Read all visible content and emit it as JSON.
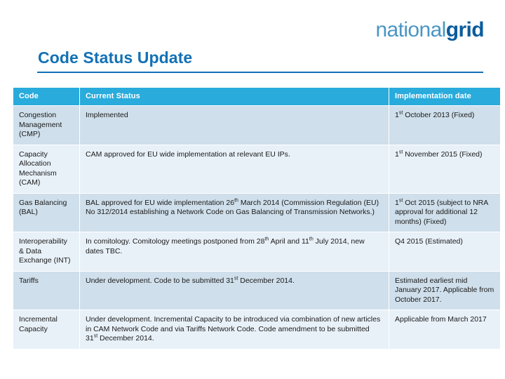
{
  "logo": {
    "text_light": "national",
    "text_bold": "grid"
  },
  "page_title": "Code Status Update",
  "colors": {
    "brand_blue": "#1271b5",
    "header_cyan": "#29ABDC",
    "row_dark": "#cfdfeb",
    "row_light": "#e8f1f8",
    "logo_light": "#4a96c4",
    "logo_bold": "#0b5c9c"
  },
  "table": {
    "headers": [
      "Code",
      "Current Status",
      "Implementation date"
    ],
    "rows": [
      {
        "code": "Congestion Management (CMP)",
        "status": "Implemented",
        "implementation": "1st October 2013 (Fixed)",
        "implementation_parts": [
          "1",
          "st",
          " October 2013 (Fixed)"
        ]
      },
      {
        "code": "Capacity Allocation Mechanism (CAM)",
        "status": "CAM approved for EU wide implementation at relevant EU IPs.",
        "implementation": "1st November 2015 (Fixed)",
        "implementation_parts": [
          "1",
          "st",
          " November 2015 (Fixed)"
        ]
      },
      {
        "code": "Gas Balancing (BAL)",
        "status": "BAL approved for EU wide implementation 26th March 2014 (Commission Regulation (EU) No 312/2014 establishing a Network Code on Gas Balancing of Transmission Networks.)",
        "status_parts": [
          "BAL approved for EU wide implementation 26",
          "th",
          " March 2014 (Commission Regulation (EU) No 312/2014 establishing a Network Code on Gas Balancing of Transmission Networks.)"
        ],
        "implementation": "1st Oct 2015 (subject to NRA approval for additional 12 months) (Fixed)",
        "implementation_parts": [
          "1",
          "st",
          " Oct 2015 (subject to NRA approval for additional 12 months) (Fixed)"
        ]
      },
      {
        "code": "Interoperability & Data Exchange (INT)",
        "status": "In comitology. Comitology meetings postponed from 28th April and 11th July 2014, new dates TBC.",
        "status_parts": [
          "In comitology. Comitology meetings postponed from 28",
          "th",
          " April and 11",
          "th",
          " July 2014, new dates TBC."
        ],
        "implementation": "Q4 2015 (Estimated)"
      },
      {
        "code": "Tariffs",
        "status": "Under development. Code to be submitted 31st December 2014.",
        "status_parts": [
          "Under development. Code to be submitted 31",
          "st",
          " December 2014."
        ],
        "implementation": "Estimated earliest mid January 2017. Applicable from October 2017."
      },
      {
        "code": "Incremental Capacity",
        "status": "Under development. Incremental Capacity to be introduced via combination of new articles in CAM Network Code and via Tariffs Network Code. Code amendment to be submitted 31st December 2014.",
        "status_parts": [
          "Under development. Incremental Capacity to be introduced via combination of new articles in CAM Network Code and via Tariffs Network Code. Code amendment to be submitted 31",
          "st",
          " December 2014."
        ],
        "implementation": "Applicable from March 2017"
      }
    ]
  }
}
